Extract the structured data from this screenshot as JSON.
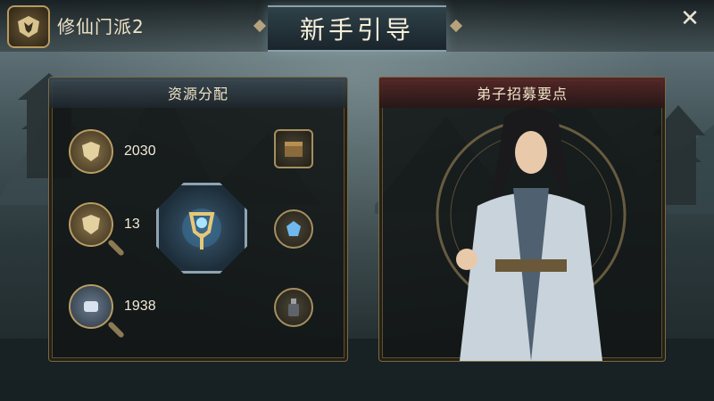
{
  "header": {
    "sect_name": "修仙门派2",
    "title": "新手引导",
    "close_symbol": "✕"
  },
  "resource_panel": {
    "title": "资源分配",
    "resources": [
      {
        "icon": "shield-badge-icon",
        "value": "2030"
      },
      {
        "icon": "shield-magnifier-icon",
        "value": "13"
      },
      {
        "icon": "scroll-magnifier-icon",
        "value": "1938"
      }
    ],
    "center_icon": "glowing-shield-axe-icon",
    "side_icons": [
      "treasure-chest-icon",
      "blue-gem-magnifier-icon",
      "bottle-magnifier-icon"
    ]
  },
  "recruit_panel": {
    "title": "弟子招募要点",
    "image": "disciple-character-portrait"
  },
  "colors": {
    "gold_border": "#b79c63",
    "panel_bg": "#121616",
    "title_text": "#f7efd9",
    "recruit_header": "#5a2828"
  }
}
